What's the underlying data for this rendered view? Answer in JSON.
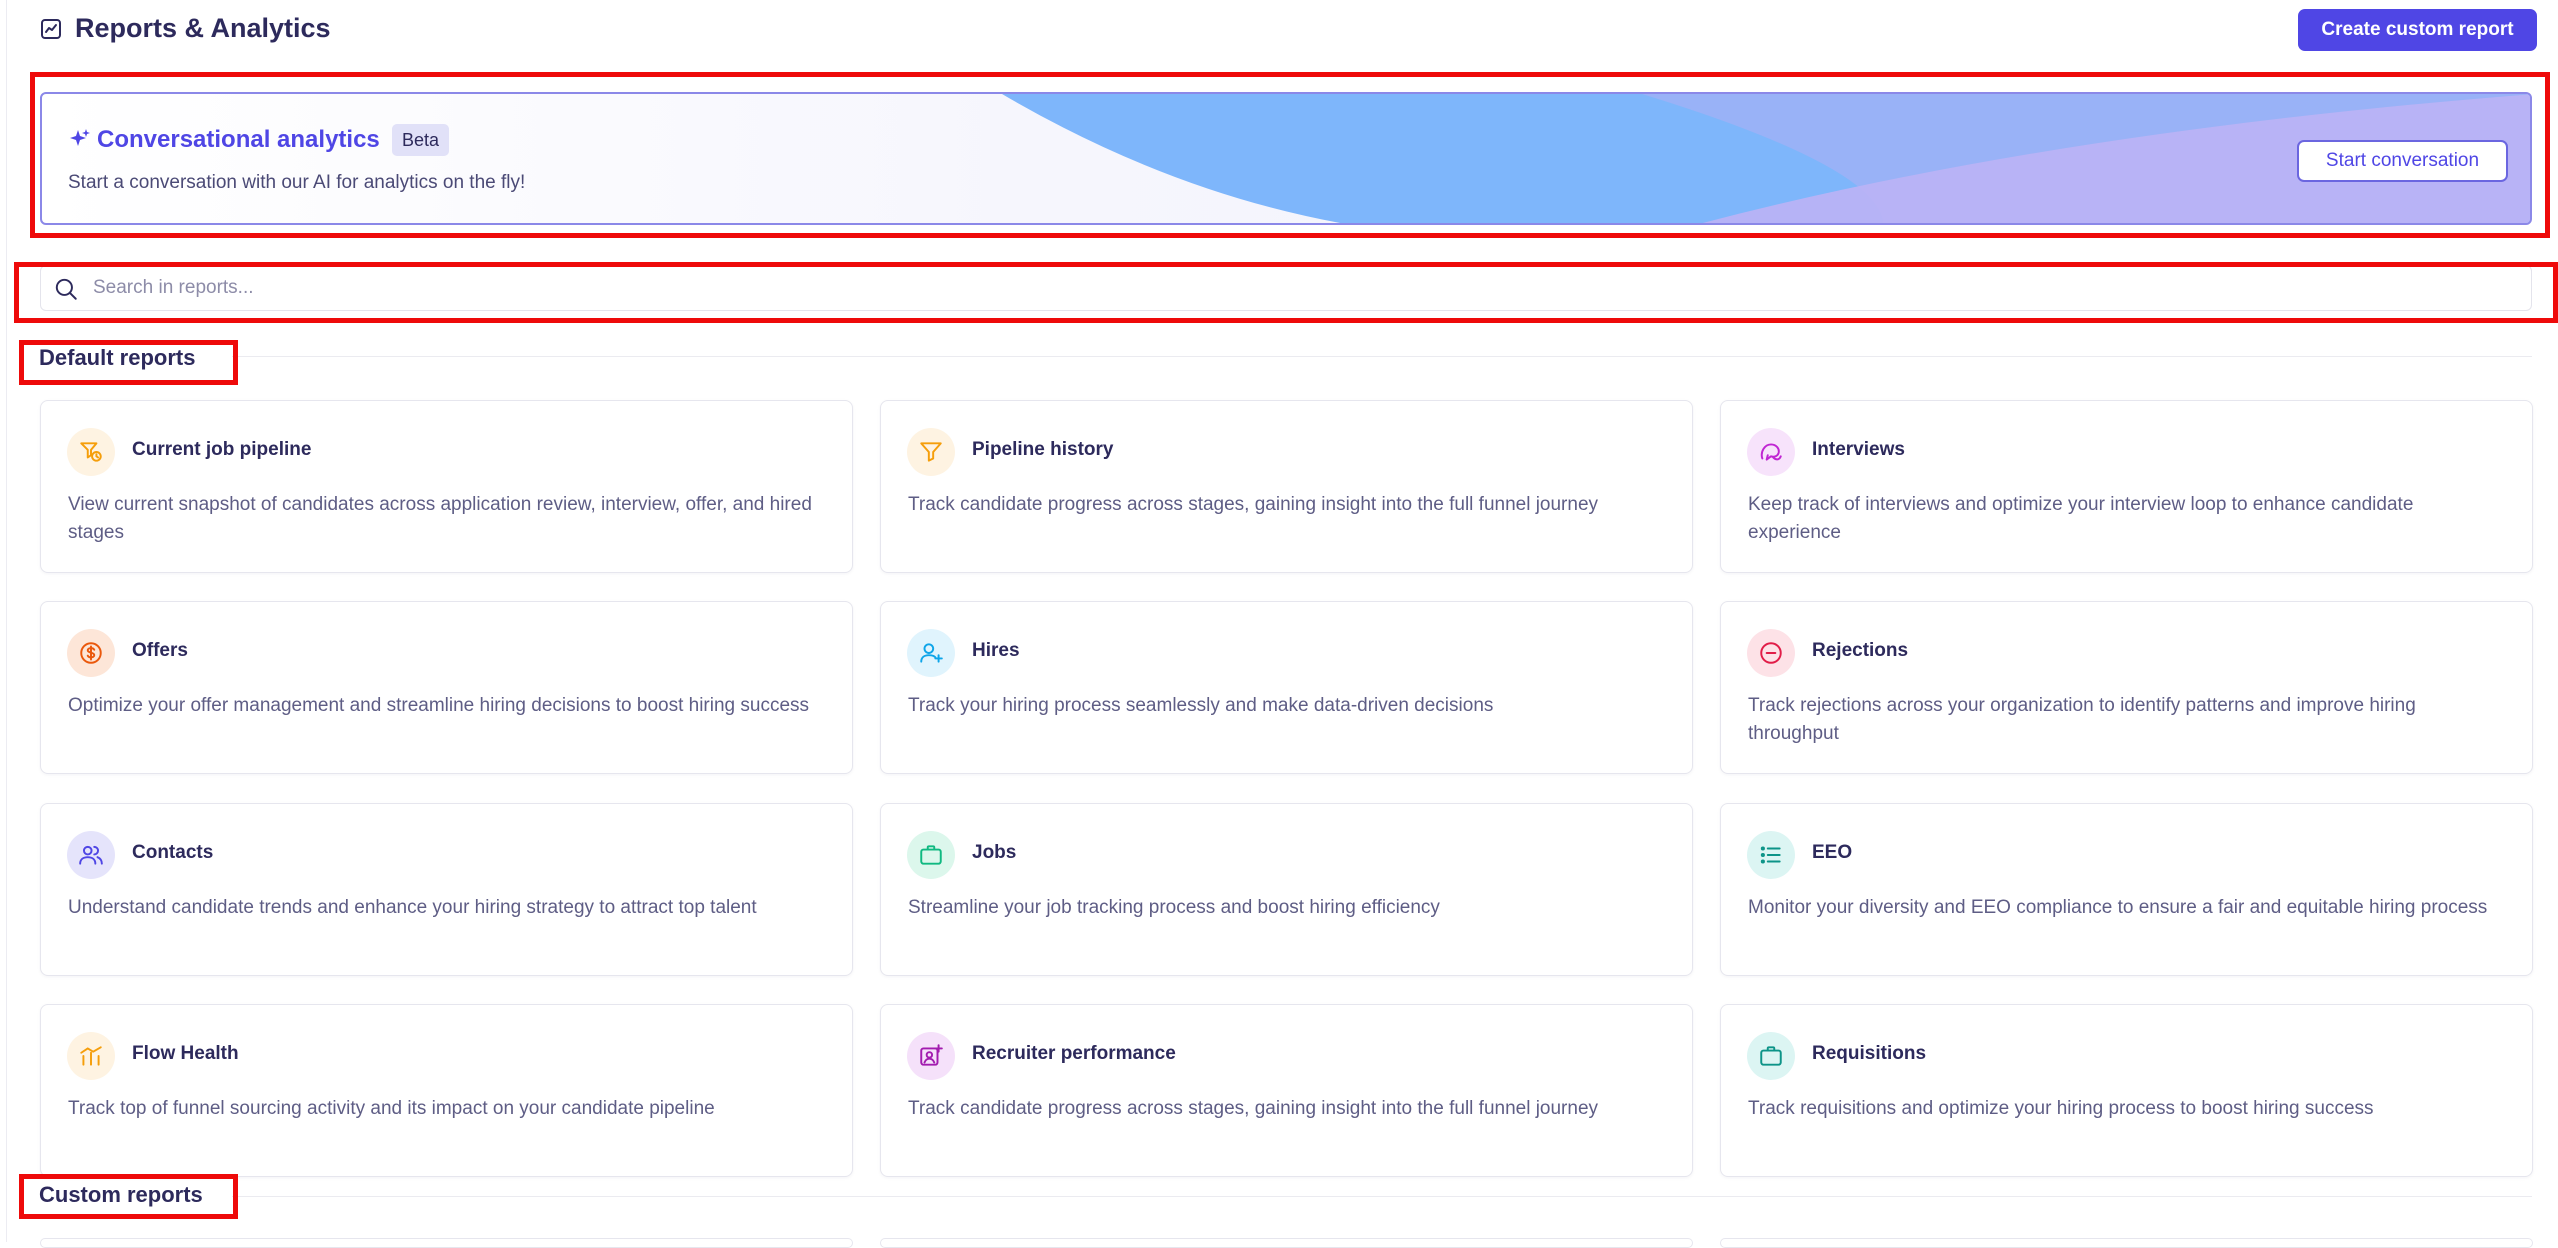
{
  "header": {
    "title": "Reports & Analytics",
    "create_button": "Create custom report"
  },
  "banner": {
    "title": "Conversational analytics",
    "badge": "Beta",
    "subtitle": "Start a conversation with our AI for analytics on the fly!",
    "button": "Start conversation"
  },
  "search": {
    "placeholder": "Search in reports...",
    "value": ""
  },
  "sections": {
    "default_title": "Default reports",
    "custom_title": "Custom reports"
  },
  "reports": [
    {
      "title": "Current job pipeline",
      "description": "View current snapshot of candidates across application review, interview, offer, and hired stages",
      "icon": "funnel-clock-icon",
      "color": "#f59e0b",
      "bg": "#fef3e2"
    },
    {
      "title": "Pipeline history",
      "description": "Track candidate progress across stages, gaining insight into the full funnel journey",
      "icon": "funnel-icon",
      "color": "#f59e0b",
      "bg": "#fef3e2"
    },
    {
      "title": "Interviews",
      "description": "Keep track of interviews and optimize your interview loop to enhance candidate experience",
      "icon": "chat-bubbles-icon",
      "color": "#c026d3",
      "bg": "#f7e3fb"
    },
    {
      "title": "Offers",
      "description": "Optimize your offer management and streamline hiring decisions to boost hiring success",
      "icon": "dollar-circle-icon",
      "color": "#ea580c",
      "bg": "#fde6d8"
    },
    {
      "title": "Hires",
      "description": "Track your hiring process seamlessly and make data-driven decisions",
      "icon": "user-plus-icon",
      "color": "#0ea5e9",
      "bg": "#e0f4fd"
    },
    {
      "title": "Rejections",
      "description": "Track rejections across your organization to identify patterns and improve hiring throughput",
      "icon": "minus-circle-icon",
      "color": "#e11d48",
      "bg": "#fde2e7"
    },
    {
      "title": "Contacts",
      "description": "Understand candidate trends and enhance your hiring strategy to attract top talent",
      "icon": "users-icon",
      "color": "#4f46e5",
      "bg": "#e5e4fb"
    },
    {
      "title": "Jobs",
      "description": "Streamline your job tracking process and boost hiring efficiency",
      "icon": "briefcase-icon",
      "color": "#10b981",
      "bg": "#dcf7ec"
    },
    {
      "title": "EEO",
      "description": "Monitor your diversity and EEO compliance to ensure a fair and equitable hiring process",
      "icon": "list-icon",
      "color": "#0d9488",
      "bg": "#dcf5f3"
    },
    {
      "title": "Flow Health",
      "description": "Track top of funnel sourcing activity and its impact on your candidate pipeline",
      "icon": "flow-chart-icon",
      "color": "#f59e0b",
      "bg": "#fef3e2"
    },
    {
      "title": "Recruiter performance",
      "description": "Track candidate progress across stages, gaining insight into the full funnel journey",
      "icon": "recruiter-icon",
      "color": "#a21caf",
      "bg": "#f5e1fa"
    },
    {
      "title": "Requisitions",
      "description": "Track requisitions and optimize your hiring process to boost hiring success",
      "icon": "briefcase-icon",
      "color": "#0d9488",
      "bg": "#dcf5f3"
    }
  ]
}
